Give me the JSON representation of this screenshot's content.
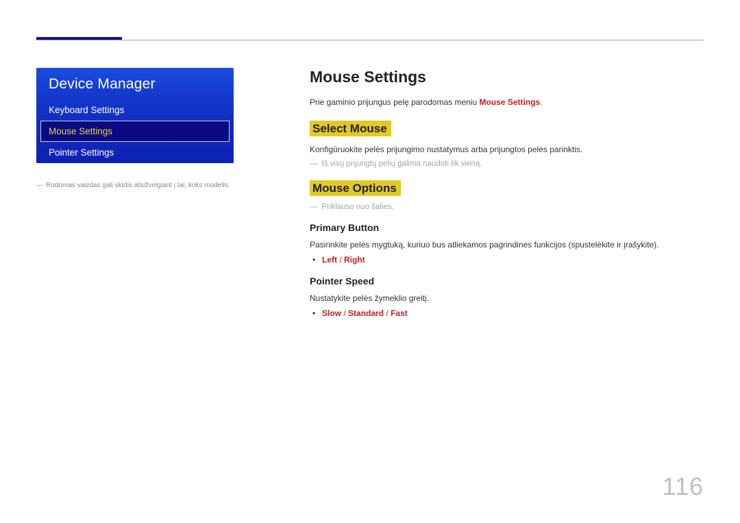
{
  "sidebar": {
    "title": "Device Manager",
    "items": [
      {
        "label": "Keyboard Settings",
        "selected": false
      },
      {
        "label": "Mouse Settings",
        "selected": true
      },
      {
        "label": "Pointer Settings",
        "selected": false
      }
    ],
    "footnote": "Rodomas vaizdas gali skirtis atsižvelgiant į tai, koks modelis."
  },
  "content": {
    "title": "Mouse Settings",
    "intro_prefix": "Prie gaminio prijungus pelę parodomas meniu ",
    "intro_highlight": "Mouse Settings",
    "intro_suffix": ".",
    "sections": {
      "select_mouse": {
        "heading": "Select Mouse",
        "body": "Konfigūruokite pelės prijungimo nustatymus arba prijungtos pelės parinktis.",
        "note": "Iš visų prijungtų pelių galima naudoti tik vieną."
      },
      "mouse_options": {
        "heading": "Mouse Options",
        "note": "Priklauso nuo šalies.",
        "primary_button": {
          "heading": "Primary Button",
          "body": "Pasirinkite pelės mygtuką, kuriuo bus atliekamos pagrindinės funkcijos (spustelėkite ir įrašykite).",
          "options": [
            "Left",
            "Right"
          ]
        },
        "pointer_speed": {
          "heading": "Pointer Speed",
          "body": "Nustatykite pelės žymeklio greitį.",
          "options": [
            "Slow",
            "Standard",
            "Fast"
          ]
        }
      }
    }
  },
  "page_number": "116"
}
